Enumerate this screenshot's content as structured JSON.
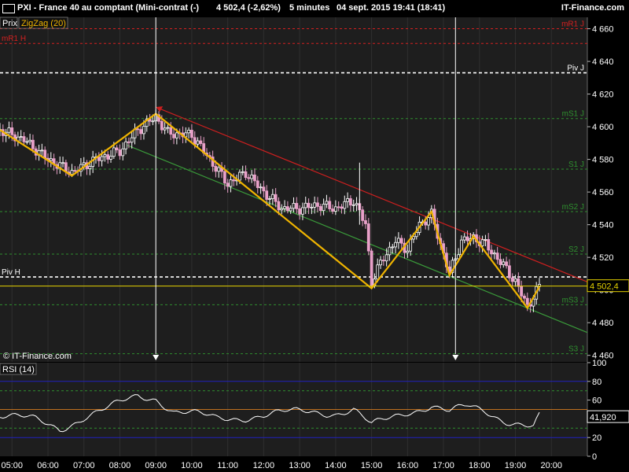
{
  "header": {
    "title": "PXI - France 40 au comptant (Mini-contrat  (-)",
    "price_change": "4 502,4 (-2,62%)",
    "interval": "5 minutes",
    "datetime": "04 sept. 2015 19:41 (18:41)",
    "brand": "IT-Finance.com"
  },
  "legend": {
    "price_label": "Prix",
    "indicator_label": "ZigZag (20)"
  },
  "watermark": "© IT-Finance.com",
  "rsi_label": "RSI (14)",
  "colors": {
    "background": "#000000",
    "panel": "#1e1e1e",
    "up_candle": "#ffffff",
    "down_candle": "#e8a0c8",
    "zigzag": "#f0b400",
    "resistance_line": "#cc1f1f",
    "support_line": "#3a9a3a",
    "price_line": "#e6d200",
    "pivot_line": "#ffffff",
    "r_level": "#d42020",
    "s_level": "#2f8f2f",
    "rsi_line": "#ffffff",
    "rsi_band": "#2020c0",
    "rsi_mid": "#c07020"
  },
  "chart_data": [
    {
      "type": "candlestick",
      "title": "PXI - France 40 au comptant (Mini-contrat  (-)",
      "x_ticks": [
        "05:00",
        "06:00",
        "07:00",
        "08:00",
        "09:00",
        "10:00",
        "11:00",
        "12:00",
        "13:00",
        "14:00",
        "15:00",
        "16:00",
        "17:00",
        "18:00",
        "19:00",
        "20:00"
      ],
      "y_ticks": [
        "4 660",
        "4 640",
        "4 620",
        "4 600",
        "4 580",
        "4 560",
        "4 540",
        "4 520",
        "4 500",
        "4 480",
        "4 460"
      ],
      "ylim": [
        4456,
        4667
      ],
      "last_value_label": "4 502,4",
      "last_value": 4502.4,
      "levels": [
        {
          "label": "mR1 J",
          "value": 4660,
          "kind": "r"
        },
        {
          "label": "mR1 H",
          "value": 4651,
          "kind": "r"
        },
        {
          "label": "Piv J",
          "value": 4633,
          "kind": "pivot"
        },
        {
          "label": "mS1 J",
          "value": 4605,
          "kind": "s"
        },
        {
          "label": "S1 J",
          "value": 4574,
          "kind": "s"
        },
        {
          "label": "mS2 J",
          "value": 4548,
          "kind": "s"
        },
        {
          "label": "S2 J",
          "value": 4522,
          "kind": "s"
        },
        {
          "label": "Piv H",
          "value": 4508,
          "kind": "pivot"
        },
        {
          "label": "mS3 J",
          "value": 4491,
          "kind": "s"
        },
        {
          "label": "S3 J",
          "value": 4461,
          "kind": "s"
        }
      ],
      "zigzag": [
        {
          "t": "04:40",
          "v": 4598
        },
        {
          "t": "06:40",
          "v": 4570
        },
        {
          "t": "09:00",
          "v": 4608
        },
        {
          "t": "15:00",
          "v": 4501
        },
        {
          "t": "16:40",
          "v": 4548
        },
        {
          "t": "17:10",
          "v": 4509
        },
        {
          "t": "17:50",
          "v": 4533
        },
        {
          "t": "19:20",
          "v": 4489
        },
        {
          "t": "19:40",
          "v": 4502
        }
      ],
      "trendlines": [
        {
          "name": "resistance",
          "from": {
            "t": "09:00",
            "v": 4612
          },
          "to": {
            "t": "21:00",
            "v": 4505
          }
        },
        {
          "name": "support",
          "from": {
            "t": "08:10",
            "v": 4589
          },
          "to": {
            "t": "21:00",
            "v": 4474
          }
        }
      ],
      "close_anchors": [
        {
          "t": "04:40",
          "v": 4598
        },
        {
          "t": "05:20",
          "v": 4592
        },
        {
          "t": "06:00",
          "v": 4580
        },
        {
          "t": "06:40",
          "v": 4572
        },
        {
          "t": "07:20",
          "v": 4580
        },
        {
          "t": "08:00",
          "v": 4585
        },
        {
          "t": "08:30",
          "v": 4598
        },
        {
          "t": "09:00",
          "v": 4606
        },
        {
          "t": "09:20",
          "v": 4596
        },
        {
          "t": "10:00",
          "v": 4595
        },
        {
          "t": "10:30",
          "v": 4580
        },
        {
          "t": "11:00",
          "v": 4565
        },
        {
          "t": "11:30",
          "v": 4572
        },
        {
          "t": "12:00",
          "v": 4560
        },
        {
          "t": "12:30",
          "v": 4550
        },
        {
          "t": "13:00",
          "v": 4550
        },
        {
          "t": "13:30",
          "v": 4552
        },
        {
          "t": "14:00",
          "v": 4550
        },
        {
          "t": "14:30",
          "v": 4555
        },
        {
          "t": "14:50",
          "v": 4540
        },
        {
          "t": "15:00",
          "v": 4505
        },
        {
          "t": "15:20",
          "v": 4520
        },
        {
          "t": "15:40",
          "v": 4530
        },
        {
          "t": "16:00",
          "v": 4525
        },
        {
          "t": "16:20",
          "v": 4540
        },
        {
          "t": "16:40",
          "v": 4546
        },
        {
          "t": "17:00",
          "v": 4522
        },
        {
          "t": "17:10",
          "v": 4510
        },
        {
          "t": "17:30",
          "v": 4530
        },
        {
          "t": "17:50",
          "v": 4532
        },
        {
          "t": "18:10",
          "v": 4528
        },
        {
          "t": "18:40",
          "v": 4515
        },
        {
          "t": "19:00",
          "v": 4505
        },
        {
          "t": "19:20",
          "v": 4490
        },
        {
          "t": "19:40",
          "v": 4502
        }
      ],
      "markers": [
        {
          "t": "09:00"
        },
        {
          "t": "17:20"
        }
      ]
    },
    {
      "type": "line",
      "title": "RSI (14)",
      "y_ticks": [
        "100",
        "80",
        "60",
        "40",
        "20",
        "0"
      ],
      "ylim": [
        0,
        100
      ],
      "levels": [
        {
          "value": 80,
          "kind": "band"
        },
        {
          "value": 70,
          "kind": "dash"
        },
        {
          "value": 50,
          "kind": "mid"
        },
        {
          "value": 30,
          "kind": "dash"
        },
        {
          "value": 20,
          "kind": "band"
        }
      ],
      "last_value_label": "41,920",
      "values_anchor": [
        {
          "t": "04:40",
          "v": 44
        },
        {
          "t": "05:40",
          "v": 38
        },
        {
          "t": "06:20",
          "v": 30
        },
        {
          "t": "07:00",
          "v": 42
        },
        {
          "t": "07:40",
          "v": 50
        },
        {
          "t": "08:00",
          "v": 56
        },
        {
          "t": "08:30",
          "v": 65
        },
        {
          "t": "09:00",
          "v": 63
        },
        {
          "t": "09:30",
          "v": 48
        },
        {
          "t": "10:00",
          "v": 45
        },
        {
          "t": "10:40",
          "v": 40
        },
        {
          "t": "11:20",
          "v": 42
        },
        {
          "t": "12:00",
          "v": 44
        },
        {
          "t": "12:40",
          "v": 46
        },
        {
          "t": "13:20",
          "v": 48
        },
        {
          "t": "14:00",
          "v": 47
        },
        {
          "t": "14:30",
          "v": 50
        },
        {
          "t": "15:00",
          "v": 32
        },
        {
          "t": "15:30",
          "v": 40
        },
        {
          "t": "16:00",
          "v": 48
        },
        {
          "t": "16:40",
          "v": 55
        },
        {
          "t": "17:10",
          "v": 47
        },
        {
          "t": "17:40",
          "v": 52
        },
        {
          "t": "18:10",
          "v": 48
        },
        {
          "t": "18:40",
          "v": 40
        },
        {
          "t": "19:10",
          "v": 35
        },
        {
          "t": "19:30",
          "v": 31
        },
        {
          "t": "19:40",
          "v": 42
        }
      ]
    }
  ]
}
